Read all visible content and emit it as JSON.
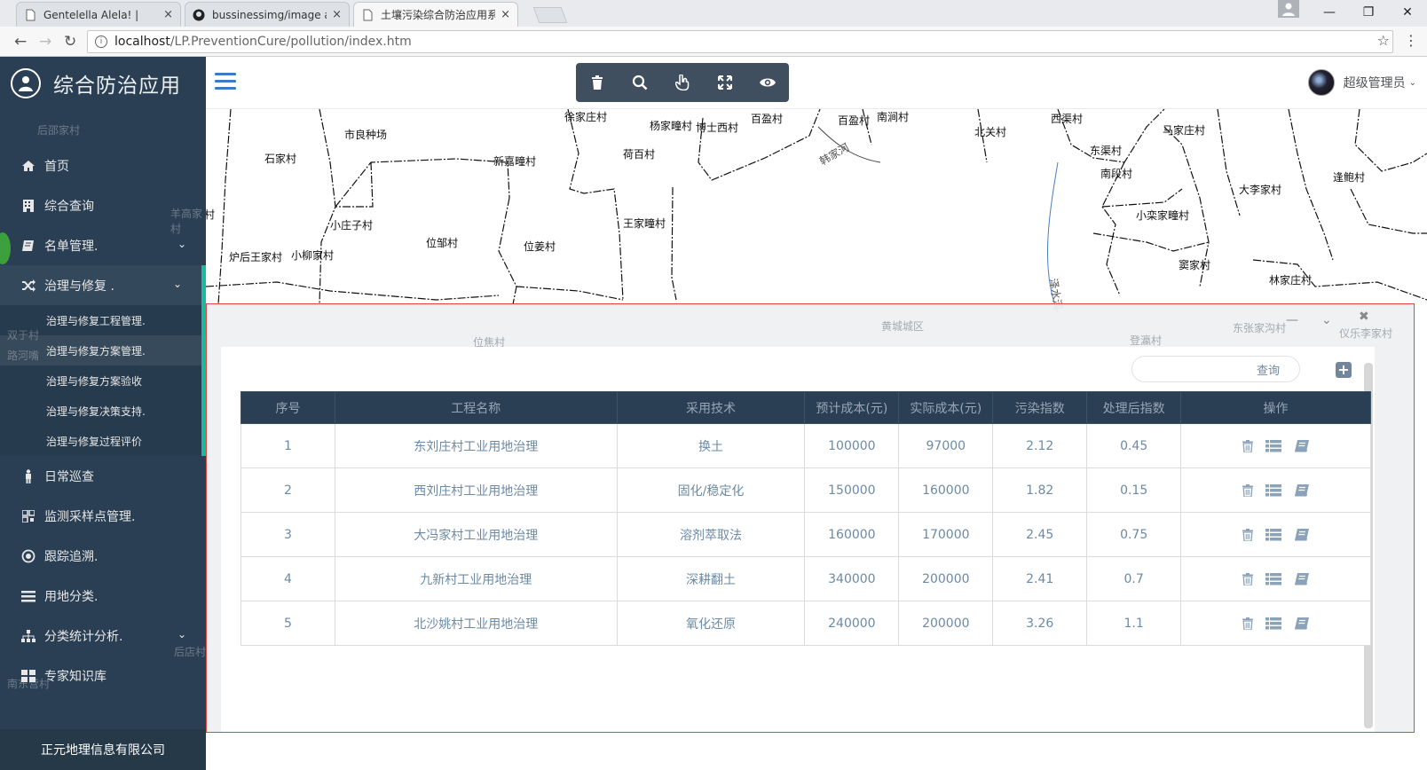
{
  "browser": {
    "tabs": [
      {
        "title": "Gentelella Alela! |",
        "active": false
      },
      {
        "title": "bussinessimg/image at",
        "active": false
      },
      {
        "title": "土壤污染综合防治应用系",
        "active": true
      }
    ],
    "close_glyph": "×",
    "url_host": "localhost",
    "url_path": "/LP.PreventionCure/pollution/index.htm",
    "window": {
      "minimize": "—",
      "restore": "❐",
      "close": "✕"
    },
    "nav": {
      "back": "←",
      "forward": "→",
      "reload": "↻"
    },
    "star": "☆",
    "menu": "⋮"
  },
  "sidebar": {
    "brand": "综合防治应用",
    "ghost_labels": [
      "后邵家村",
      "羊高家村",
      "双于村",
      "路河嘴",
      "后店村",
      "南东营村"
    ],
    "items": [
      {
        "label": "首页",
        "icon": "home-icon",
        "chevron": false
      },
      {
        "label": "综合查询",
        "icon": "building-icon",
        "chevron": false
      },
      {
        "label": "名单管理.",
        "icon": "book-icon",
        "chevron": true
      },
      {
        "label": "治理与修复 .",
        "icon": "random-icon",
        "chevron": true,
        "active": true
      }
    ],
    "submenu": [
      {
        "label": "治理与修复工程管理.",
        "current": false
      },
      {
        "label": "治理与修复方案管理.",
        "current": true
      },
      {
        "label": "治理与修复方案验收",
        "current": false
      },
      {
        "label": "治理与修复决策支持.",
        "current": false
      },
      {
        "label": "治理与修复过程评价",
        "current": false
      }
    ],
    "items_after": [
      {
        "label": "日常巡查",
        "icon": "person-icon",
        "chevron": false
      },
      {
        "label": "监测采样点管理.",
        "icon": "qrcode-icon",
        "chevron": false
      },
      {
        "label": "跟踪追溯.",
        "icon": "target-icon",
        "chevron": false
      },
      {
        "label": "用地分类.",
        "icon": "list-icon",
        "chevron": false
      },
      {
        "label": "分类统计分析.",
        "icon": "sitemap-icon",
        "chevron": true
      },
      {
        "label": "专家知识库",
        "icon": "grid-icon",
        "chevron": false
      }
    ],
    "chevron_glyph": "⌄",
    "footer": "正元地理信息有限公司"
  },
  "topnav": {
    "user_name": "超级管理员",
    "caret": "⌄",
    "tools": [
      "trash-icon",
      "search-icon",
      "hand-pointer-icon",
      "fullscreen-icon",
      "eye-icon"
    ]
  },
  "map": {
    "villages": [
      "徐家庄村",
      "杨家疃村",
      "博士西村",
      "百盈村",
      "百盈村",
      "南涧村",
      "北关村",
      "西渠村",
      "马家庄村",
      "东渠村",
      "南段村",
      "大李家村",
      "逢鲍村",
      "小栾家疃村",
      "窦家村",
      "林家庄村",
      "市良种场",
      "石家村",
      "新嘉疃村",
      "荷百村",
      "王家疃村",
      "小庄子村",
      "位邹村",
      "位姜村",
      "炉后王家村",
      "小柳家村",
      "羊高家村"
    ],
    "road_labels": [
      "韩家河",
      "泽水河"
    ]
  },
  "panel": {
    "ghost_labels": [
      "黄城城区",
      "位焦村",
      "登瀛村",
      "东张家沟村",
      "仪乐李家村"
    ],
    "controls": {
      "minimize": "—",
      "collapse": "⌄",
      "close": "✖"
    },
    "search_button": "查询",
    "search_placeholder": "",
    "add_glyph": "+",
    "table": {
      "headers": [
        "序号",
        "工程名称",
        "采用技术",
        "预计成本(元)",
        "实际成本(元)",
        "污染指数",
        "处理后指数",
        "操作"
      ],
      "rows": [
        [
          "1",
          "东刘庄村工业用地治理",
          "换土",
          "100000",
          "97000",
          "2.12",
          "0.45"
        ],
        [
          "2",
          "西刘庄村工业用地治理",
          "固化/稳定化",
          "150000",
          "160000",
          "1.82",
          "0.15"
        ],
        [
          "3",
          "大冯家村工业用地治理",
          "溶剂萃取法",
          "160000",
          "170000",
          "2.45",
          "0.75"
        ],
        [
          "4",
          "九新村工业用地治理",
          "深耕翻土",
          "340000",
          "200000",
          "2.41",
          "0.7"
        ],
        [
          "5",
          "北沙姚村工业用地治理",
          "氧化还原",
          "240000",
          "200000",
          "3.26",
          "1.1"
        ]
      ],
      "row_actions": [
        "trash-icon",
        "list-icon",
        "book-icon"
      ]
    }
  },
  "colors": {
    "sidebar_bg": "#2a3f54",
    "accent_green": "#1abb9c",
    "toolbar_bg": "#404f5f",
    "header_bg": "#2a3f54",
    "cell_text": "#6c8aa6",
    "panel_border": "#e04545"
  }
}
